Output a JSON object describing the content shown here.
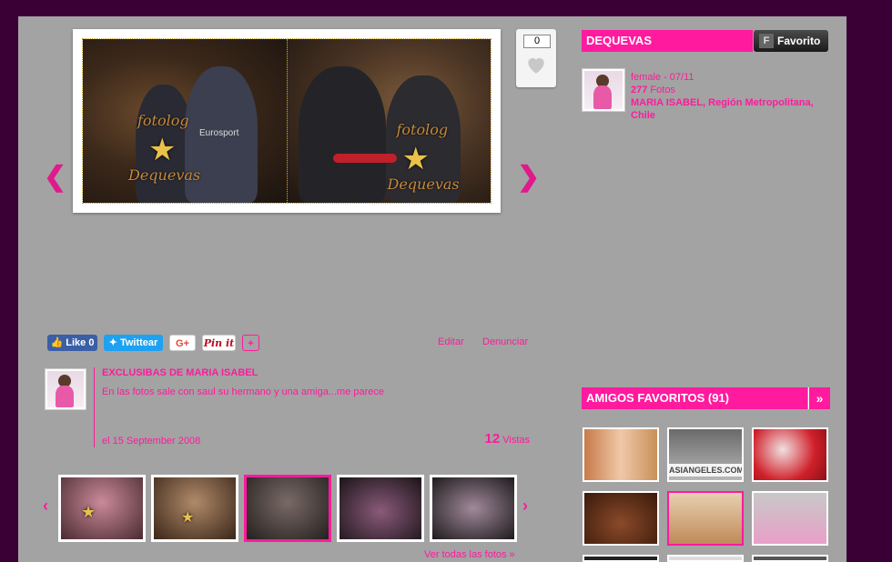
{
  "photo": {
    "watermark_top": "fotolog",
    "watermark_bottom": "Dequevas",
    "shirt_text": "Eurosport"
  },
  "like": {
    "count": "0"
  },
  "profile": {
    "username": "DEQUEVAS",
    "favorite_label": "Favorito",
    "favorite_icon": "F",
    "gender_birth": "female - 07/11",
    "photos_count": "277",
    "photos_label": "Fotos",
    "location": "MARIA ISABEL, Región Metropolitana, Chile"
  },
  "share": {
    "facebook": "Like 0",
    "twitter": "Twittear",
    "gplus": "G+",
    "pinit": "Pin it",
    "more": "+"
  },
  "actions": {
    "edit": "Editar",
    "report": "Denunciar"
  },
  "post": {
    "title": "EXCLUSIBAS DE MARIA ISABEL",
    "description": "En las fotos sale con saul su hermano y una amiga...me parece",
    "date": "el 15 September 2008",
    "views_count": "12",
    "views_label": "Vistas"
  },
  "friends": {
    "title": "AMIGOS FAVORITOS (91)",
    "more_icon": "»",
    "banner_text": "ASIANGELES.COM"
  },
  "thumbs": {
    "see_all": "Ver todas las fotos »"
  },
  "icons": {
    "prev": "❮",
    "next": "❯",
    "thumb_prev": "‹",
    "thumb_next": "›"
  },
  "colors": {
    "accent": "#ff1a9e",
    "page_bg": "#a3a3a3",
    "outer_bg": "#3a0036"
  }
}
